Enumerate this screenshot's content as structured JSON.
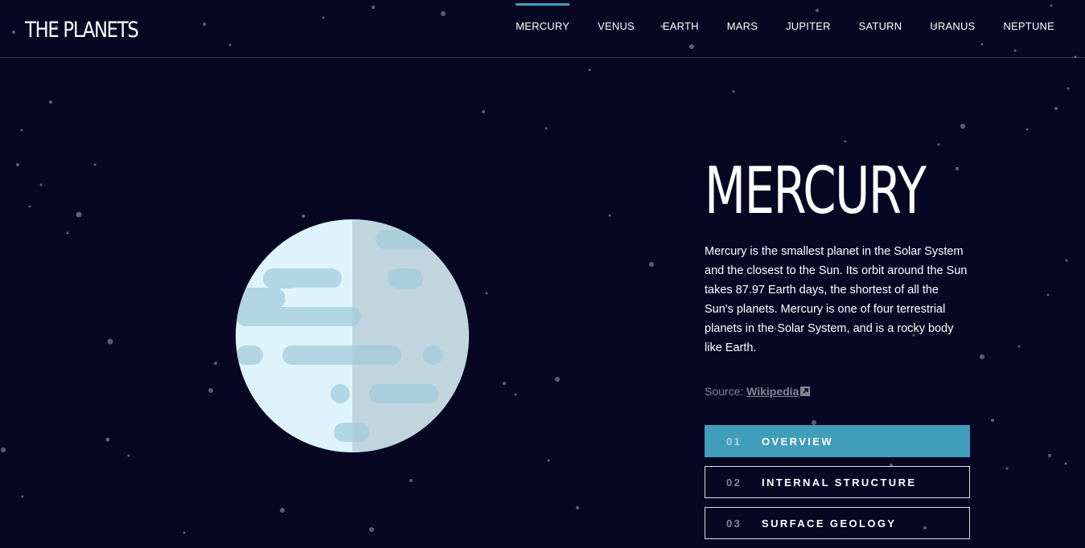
{
  "header": {
    "logo": "THE PLANETS",
    "nav": [
      "MERCURY",
      "VENUS",
      "EARTH",
      "MARS",
      "JUPITER",
      "SATURN",
      "URANUS",
      "NEPTUNE"
    ],
    "active_nav": "MERCURY"
  },
  "planet": {
    "name": "MERCURY",
    "description": "Mercury is the smallest planet in the Solar System and the closest to the Sun. Its orbit around the Sun takes 87.97 Earth days, the shortest of all the Sun's planets. Mercury is one of four terrestrial planets in the Solar System, and is a rocky body like Earth.",
    "source_label": "Source:",
    "source_link": "Wikipedia"
  },
  "tabs": [
    {
      "num": "01",
      "label": "OVERVIEW"
    },
    {
      "num": "02",
      "label": "INTERNAL STRUCTURE"
    },
    {
      "num": "03",
      "label": "SURFACE GEOLOGY"
    }
  ],
  "colors": {
    "background": "#070724",
    "accent": "#419EBB",
    "planet_light": "#DEF4FC",
    "planet_shadow": "#CADFE6",
    "planet_spots": "#B2D6E4"
  }
}
